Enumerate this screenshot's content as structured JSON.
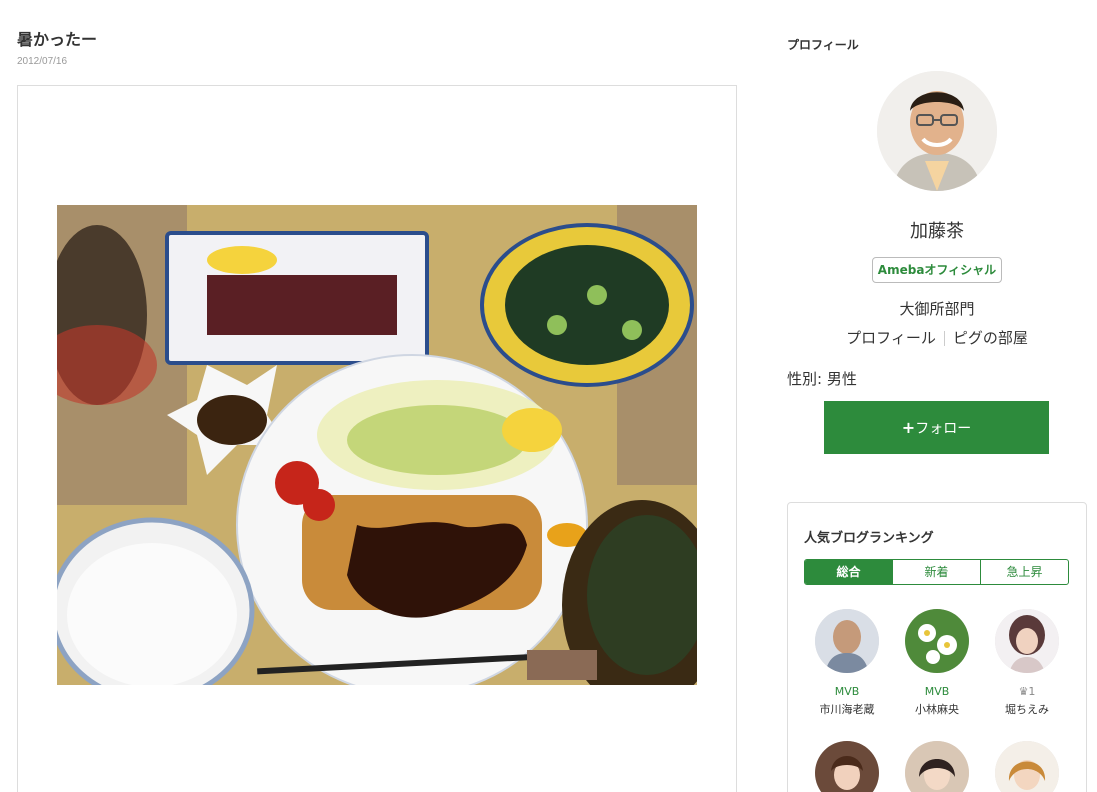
{
  "post": {
    "title": "暑かったー",
    "date": "2012/07/16"
  },
  "profile": {
    "heading": "プロフィール",
    "name": "加藤茶",
    "official_badge": "Amebaオフィシャル",
    "organization": "大御所部門",
    "link_profile": "プロフィール",
    "link_room": "ピグの部屋",
    "gender": "性別: 男性",
    "follow_plus": "+",
    "follow_label": "フォロー"
  },
  "ranking": {
    "title": "人気ブログランキング",
    "tabs": [
      "総合",
      "新着",
      "急上昇"
    ],
    "active_tab": "総合",
    "items": [
      {
        "badge": "MVB",
        "name": "市川海老蔵"
      },
      {
        "badge": "MVB",
        "name": "小林麻央"
      },
      {
        "badge": "♛1",
        "name": "堀ちえみ"
      },
      {
        "badge": "",
        "name": ""
      },
      {
        "badge": "",
        "name": ""
      },
      {
        "badge": "",
        "name": ""
      }
    ]
  },
  "colors": {
    "accent": "#2d8b3c",
    "border": "#dddddd"
  }
}
